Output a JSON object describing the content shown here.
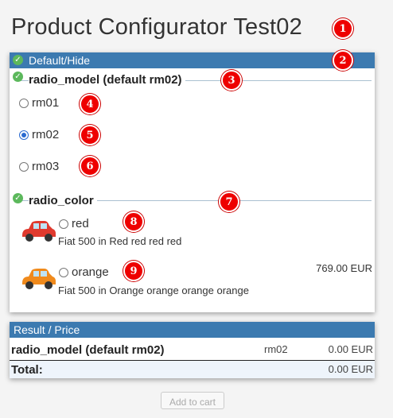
{
  "page": {
    "title": "Product Configurator Test02"
  },
  "markers": [
    "1",
    "2",
    "3",
    "4",
    "5",
    "6",
    "7",
    "8",
    "9"
  ],
  "config_panel": {
    "header": "Default/Hide"
  },
  "radio_model": {
    "title": "radio_model (default rm02)",
    "options": [
      {
        "label": "rm01",
        "selected": false
      },
      {
        "label": "rm02",
        "selected": true
      },
      {
        "label": "rm03",
        "selected": false
      }
    ]
  },
  "radio_color": {
    "title": "radio_color",
    "options": [
      {
        "label": "red",
        "description": "Fiat 500 in Red red red red",
        "price": "",
        "car_color": "#e03a2e",
        "selected": false
      },
      {
        "label": "orange",
        "description": "Fiat 500 in Orange orange orange orange",
        "price": "769.00 EUR",
        "car_color": "#f08a1c",
        "selected": false
      }
    ]
  },
  "result": {
    "header": "Result / Price",
    "row": {
      "name": "radio_model (default rm02)",
      "value": "rm02",
      "price": "0.00 EUR"
    },
    "total_label": "Total:",
    "total_price": "0.00 EUR"
  },
  "cart": {
    "button_label": "Add to cart"
  }
}
